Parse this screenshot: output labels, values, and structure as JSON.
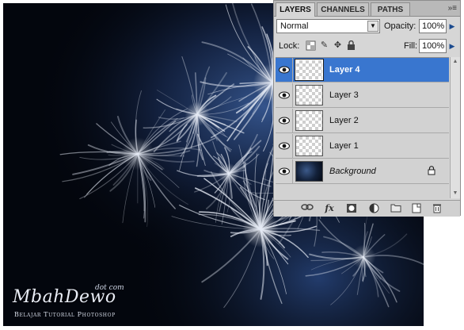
{
  "panel": {
    "tabs": [
      "LAYERS",
      "CHANNELS",
      "PATHS"
    ],
    "menu_icon": "panel-menu-icon",
    "blend_mode": "Normal",
    "opacity_label": "Opacity:",
    "opacity_value": "100%",
    "lock_label": "Lock:",
    "fill_label": "Fill:",
    "fill_value": "100%",
    "lock_icons": [
      "lock-transparent-icon",
      "lock-paint-icon",
      "lock-move-icon",
      "lock-all-icon"
    ],
    "layers": [
      {
        "name": "Layer 4",
        "selected": true,
        "visible": true
      },
      {
        "name": "Layer 3",
        "selected": false,
        "visible": true
      },
      {
        "name": "Layer 2",
        "selected": false,
        "visible": true
      },
      {
        "name": "Layer 1",
        "selected": false,
        "visible": true
      },
      {
        "name": "Background",
        "selected": false,
        "visible": true,
        "locked": true
      }
    ],
    "footer_icons": [
      "link-layers-icon",
      "layer-style-icon",
      "layer-mask-icon",
      "adjustment-layer-icon",
      "new-group-icon",
      "new-layer-icon",
      "delete-layer-icon"
    ]
  },
  "watermark": {
    "main": "MbahDewo",
    "suffix": "dot com",
    "subtitle": "Belajar Tutorial Photoshop"
  },
  "colors": {
    "selection": "#3976cf",
    "canvas_bg": "#03060d",
    "glow": "#1f3b6e"
  }
}
